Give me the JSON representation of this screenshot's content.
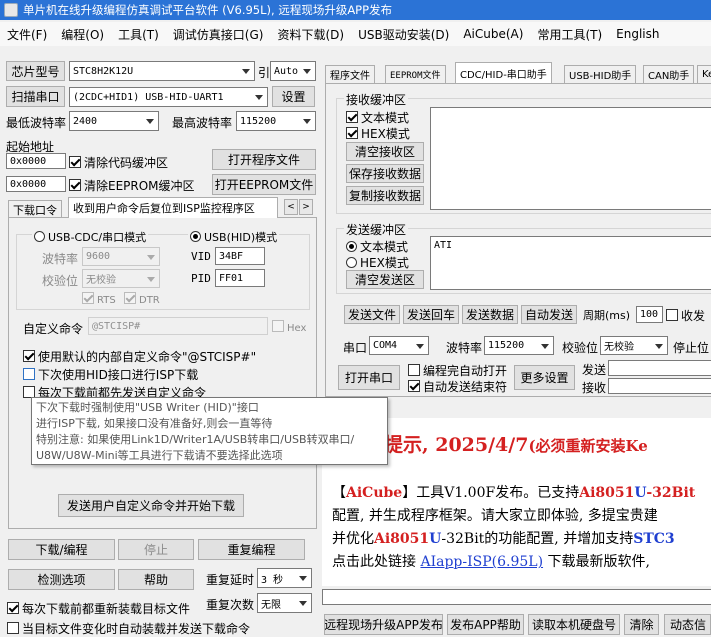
{
  "window": {
    "title": "单片机在线升级编程仿真调试平台软件 (V6.95L), 远程现场升级APP发布"
  },
  "menu": [
    "文件(F)",
    "编程(O)",
    "工具(T)",
    "调试仿真接口(G)",
    "资料下载(D)",
    "USB驱动安装(D)",
    "AiCube(A)",
    "常用工具(T)",
    "English"
  ],
  "left": {
    "chip_label": "芯片型号",
    "chip_value": "STC8H2K12U",
    "pin_label": "引脚数",
    "pin_value": "Auto",
    "scan_button": "扫描串口",
    "port_value": "(2CDC+HID1) USB-HID-UART1",
    "settings_button": "设置",
    "min_baud_label": "最低波特率",
    "min_baud_value": "2400",
    "max_baud_label": "最高波特率",
    "max_baud_value": "115200",
    "start_addr_label": "起始地址",
    "addr1": "0x0000",
    "clear_code_label": "清除代码缓冲区",
    "open_prog_button": "打开程序文件",
    "addr2": "0x0000",
    "clear_eeprom_label": "清除EEPROM缓冲区",
    "open_eeprom_button": "打开EEPROM文件",
    "tabs": [
      "下载口令",
      "收到用户命令后复位到ISP监控程序区"
    ],
    "tab_prev": "<",
    "tab_next": ">",
    "mode_cdc": "USB-CDC/串口模式",
    "mode_hid": "USB(HID)模式",
    "baud_label": "波特率",
    "baud_value": "9600",
    "parity_label": "校验位",
    "parity_value": "无校验",
    "rts_label": "RTS",
    "dtr_label": "DTR",
    "vid_label": "VID",
    "vid_value": "34BF",
    "pid_label": "PID",
    "pid_value": "FF01",
    "custom_cmd_label": "自定义命令",
    "custom_cmd_value": "@STCISP#",
    "hex_label": "Hex",
    "use_default_label": "使用默认的内部自定义命令\"@STCISP#\"",
    "next_download_label": "下次使用HID接口进行ISP下载",
    "send_before_label": "每次下载前都先发送自定义命令",
    "tooltip_lines": [
      "下次下载时强制使用\"USB Writer (HID)\"接口",
      "进行ISP下载, 如果接口没有准备好,则会一直等待",
      "特别注意: 如果使用Link1D/Writer1A/USB转串口/USB转双串口/",
      "U8W/U8W-Mini等工具进行下载请不要选择此选项"
    ],
    "send_and_download_button": "发送用户自定义命令并开始下载",
    "download_button": "下载/编程",
    "stop_button": "停止",
    "reprogram_button": "重复编程",
    "detect_button": "检测选项",
    "help_button": "帮助",
    "repeat_delay_label": "重复延时",
    "repeat_delay_value": "3 秒",
    "repeat_count_label": "重复次数",
    "repeat_count_value": "无限",
    "reload_label": "每次下载前都重新装载目标文件",
    "auto_load_label": "当目标文件变化时自动装载并发送下载命令"
  },
  "right": {
    "tabs": [
      "程序文件",
      "EEPROM文件",
      "CDC/HID-串口助手",
      "USB-HID助手",
      "CAN助手",
      "Ke"
    ],
    "recv_group": "接收缓冲区",
    "recv_text_mode": "文本模式",
    "recv_hex_mode": "HEX模式",
    "clear_recv_button": "清空接收区",
    "save_recv_button": "保存接收数据",
    "copy_recv_button": "复制接收数据",
    "send_group": "发送缓冲区",
    "send_text_mode": "文本模式",
    "send_hex_mode": "HEX模式",
    "clear_send_button": "清空发送区",
    "send_content": "ATI",
    "send_file_button": "发送文件",
    "send_return_button": "发送回车",
    "send_data_button": "发送数据",
    "auto_send_button": "自动发送",
    "period_label": "周期(ms)",
    "period_value": "100",
    "recv_save_label": "收发",
    "port_label": "串口",
    "port_value": "COM4",
    "baud_label": "波特率",
    "baud_value": "115200",
    "parity_label": "校验位",
    "parity_value": "无校验",
    "stop_label": "停止位",
    "open_port_button": "打开串口",
    "auto_open_label": "编程完自动打开",
    "auto_close_label": "自动发送结束符",
    "more_settings_button": "更多设置",
    "send_count_label": "发送",
    "recv_count_label": "接收"
  },
  "news": {
    "headline_a": "提示, ",
    "headline_date": "2025/4/7",
    "headline_b": "(必须重新安装Ke",
    "p1_bracket_open": "【",
    "p1_aicube": "AiCube",
    "p1_bracket_close": "】",
    "p1_text": "工具V1.00F发布。已支持",
    "p1_ai": "Ai8051",
    "p1_u": "U",
    "p1_32bit": "-32Bit",
    "p2_text": "配置, 并生成程序框架。请大家立即体验, 多提宝贵建",
    "p3_text1": "并优化",
    "p3_ai": "Ai8051",
    "p3_u": "U",
    "p3_text2": "-32Bit的功能配置, 并增加支持",
    "p3_stc": "STC3",
    "p4_text1": "点击此处链接 ",
    "p4_link": "AIapp-ISP(6.95L)",
    "p4_text2": " 下载最新版软件,"
  },
  "bottom": {
    "remote_upgrade_button": "远程现场升级APP发布",
    "publish_help_button": "发布APP帮助",
    "read_disk_button": "读取本机硬盘号",
    "clear_button": "清除",
    "dynamic_button": "动态信"
  }
}
